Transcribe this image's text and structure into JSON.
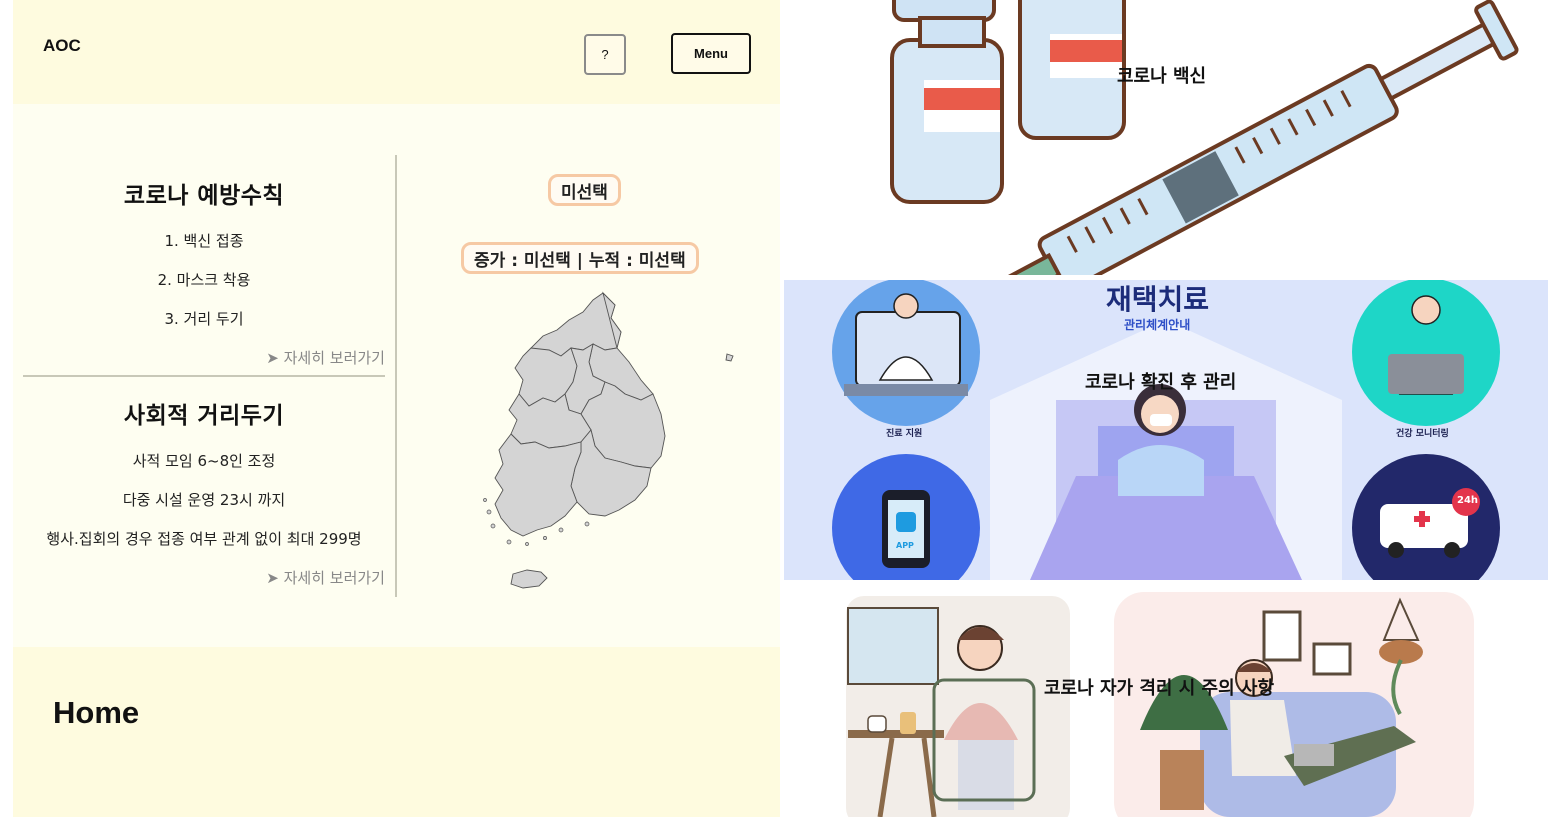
{
  "header": {
    "logo": "AOC",
    "help_label": "?",
    "menu_label": "Menu"
  },
  "rules": {
    "title": "코로나 예방수칙",
    "items": [
      "1. 백신 접종",
      "2. 마스크 착용",
      "3. 거리 두기"
    ],
    "more_label": "➤ 자세히 보러가기"
  },
  "distancing": {
    "title": "사회적 거리두기",
    "items": [
      "사적 모임 6~8인 조정",
      "다중 시설 운영 23시 까지",
      "행사.집회의 경우 접종 여부 관계 없이 최대 299명"
    ],
    "more_label": "➤ 자세히 보러가기"
  },
  "map_panel": {
    "region_label": "미선택",
    "stats_label": "증가 : 미선택 | 누적 : 미선택"
  },
  "footer": {
    "title": "Home"
  },
  "cards": [
    {
      "caption": "코로나 백신",
      "image_desc": "vaccine-vials-and-syringe"
    },
    {
      "caption": "코로나 확진 후 관리",
      "banner_title": "재택치료",
      "banner_subtitle": "관리체계안내",
      "labels": [
        "진료 지원",
        "건강 모니터링",
        "APP",
        "24h"
      ]
    },
    {
      "caption": "코로나 자가 격리 시 주의 사항",
      "image_desc": "people-at-home"
    }
  ],
  "colors": {
    "header_bg": "#fefbdf",
    "main_bg": "#fefef1",
    "pill_border": "#f6c9a4",
    "map_fill": "#d4d4d4",
    "banner_bg": "#dbe4fb"
  }
}
